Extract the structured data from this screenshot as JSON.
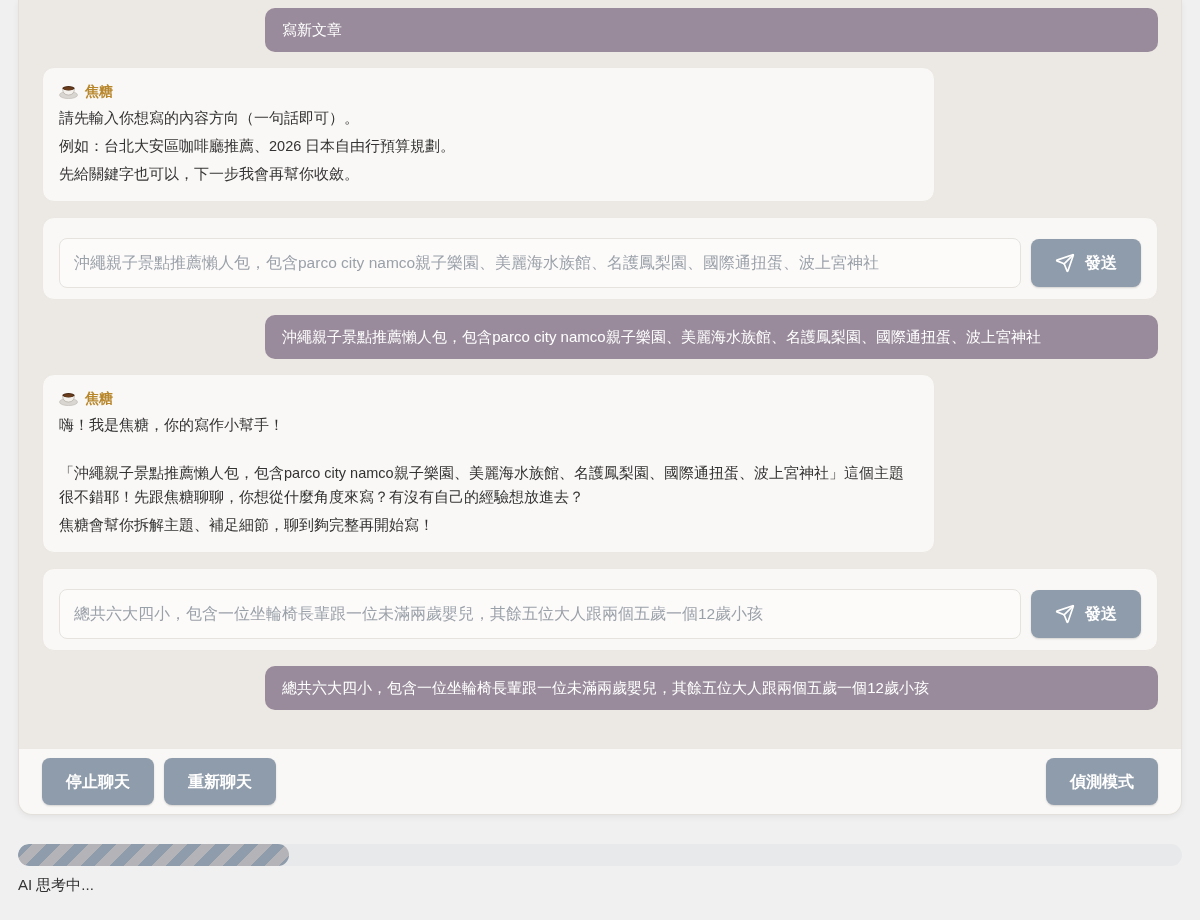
{
  "messages": [
    {
      "kind": "user",
      "text": "寫新文章"
    },
    {
      "kind": "bot",
      "sender": "焦糖",
      "paragraphs": [
        [
          "請先輸入你想寫的內容方向（一句話即可）。",
          "例如：台北大安區咖啡廳推薦、2026 日本自由行預算規劃。",
          "先給關鍵字也可以，下一步我會再幫你收斂。"
        ]
      ]
    },
    {
      "kind": "input",
      "placeholder": "沖繩親子景點推薦懶人包，包含parco city namco親子樂園、美麗海水族館、名護鳳梨園、國際通扭蛋、波上宮神社",
      "button": "發送"
    },
    {
      "kind": "user",
      "text": "沖繩親子景點推薦懶人包，包含parco city namco親子樂園、美麗海水族館、名護鳳梨園、國際通扭蛋、波上宮神社"
    },
    {
      "kind": "bot",
      "sender": "焦糖",
      "paragraphs": [
        [
          "嗨！我是焦糖，你的寫作小幫手！"
        ],
        [
          "「沖繩親子景點推薦懶人包，包含parco city namco親子樂園、美麗海水族館、名護鳳梨園、國際通扭蛋、波上宮神社」這個主題很不錯耶！先跟焦糖聊聊，你想從什麼角度來寫？有沒有自己的經驗想放進去？",
          "焦糖會幫你拆解主題、補足細節，聊到夠完整再開始寫！"
        ]
      ]
    },
    {
      "kind": "input",
      "placeholder": "總共六大四小，包含一位坐輪椅長輩跟一位未滿兩歲嬰兒，其餘五位大人跟兩個五歲一個12歲小孩",
      "button": "發送"
    },
    {
      "kind": "user",
      "text": "總共六大四小，包含一位坐輪椅長輩跟一位未滿兩歲嬰兒，其餘五位大人跟兩個五歲一個12歲小孩"
    }
  ],
  "footer": {
    "left_buttons": [
      "停止聊天",
      "重新聊天"
    ],
    "right_buttons": [
      "偵測模式"
    ]
  },
  "progress": {
    "level": 0.233
  },
  "status": "AI 思考中..."
}
